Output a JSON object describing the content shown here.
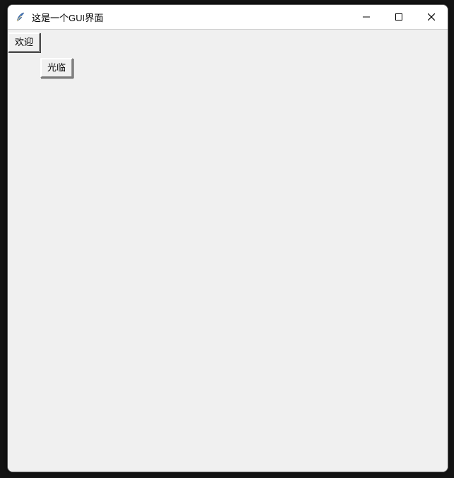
{
  "window": {
    "title": "这是一个GUI界面"
  },
  "buttons": {
    "welcome": "欢迎",
    "visit": "光临"
  }
}
